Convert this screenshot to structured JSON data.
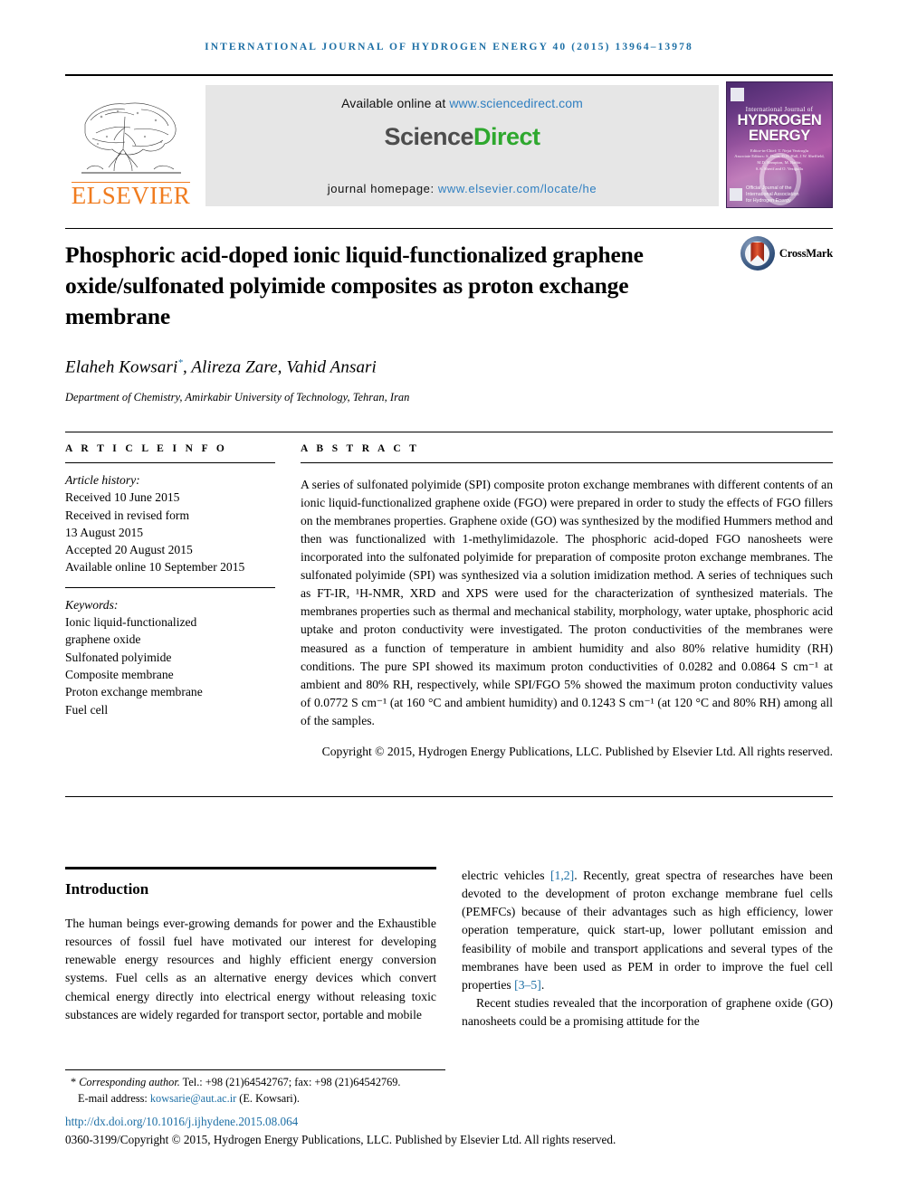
{
  "running_head": "International Journal of Hydrogen Energy 40 (2015) 13964–13978",
  "masthead": {
    "publisher_name": "ELSEVIER",
    "available_prefix": "Available online at ",
    "available_url": "www.sciencedirect.com",
    "sciencedirect_part1": "Science",
    "sciencedirect_part2": "Direct",
    "homepage_prefix": "journal homepage: ",
    "homepage_url": "www.elsevier.com/locate/he",
    "cover": {
      "line_small": "International Journal of",
      "line_big_1": "HYDROGEN",
      "line_big_2": "ENERGY",
      "editor_lines": "Editor-in-Chief: T. Nejat Veziroglu\nAssociate Editors: S. Dunn, D.O. Hall, J.W. Sheffield,\nM.D. Hampton, M. Barbir,\nS.A. Sherif and O. Veziğullu",
      "footer_text": "Official Journal of the\nInternational Association\nfor Hydrogen Energy"
    }
  },
  "article": {
    "title": "Phosphoric acid-doped ionic liquid-functionalized graphene oxide/sulfonated polyimide composites as proton exchange membrane",
    "crossmark_label": "CrossMark",
    "authors": "Elaheh Kowsari",
    "authors_star": "*",
    "authors_rest": ", Alireza Zare, Vahid Ansari",
    "affiliation": "Department of Chemistry, Amirkabir University of Technology, Tehran, Iran"
  },
  "article_info": {
    "section_label": "A R T I C L E   I N F O",
    "history_label": "Article history:",
    "history": [
      "Received 10 June 2015",
      "Received in revised form",
      "13 August 2015",
      "Accepted 20 August 2015",
      "Available online 10 September 2015"
    ],
    "keywords_label": "Keywords:",
    "keywords": [
      "Ionic liquid-functionalized",
      "graphene oxide",
      "Sulfonated polyimide",
      "Composite membrane",
      "Proton exchange membrane",
      "Fuel cell"
    ]
  },
  "abstract": {
    "section_label": "A B S T R A C T",
    "body": "A series of sulfonated polyimide (SPI) composite proton exchange membranes with different contents of an ionic liquid-functionalized graphene oxide (FGO) were prepared in order to study the effects of FGO fillers on the membranes properties. Graphene oxide (GO) was synthesized by the modified Hummers method and then was functionalized with 1-methylimidazole. The phosphoric acid-doped FGO nanosheets were incorporated into the sulfonated polyimide for preparation of composite proton exchange membranes. The sulfonated polyimide (SPI) was synthesized via a solution imidization method. A series of techniques such as FT-IR, ¹H-NMR, XRD and XPS were used for the characterization of synthesized materials. The membranes properties such as thermal and mechanical stability, morphology, water uptake, phosphoric acid uptake and proton conductivity were investigated. The proton conductivities of the membranes were measured as a function of temperature in ambient humidity and also 80% relative humidity (RH) conditions. The pure SPI showed its maximum proton conductivities of 0.0282 and 0.0864 S cm⁻¹ at ambient and 80% RH, respectively, while SPI/FGO 5% showed the maximum proton conductivity values of 0.0772 S cm⁻¹ (at 160 °C and ambient humidity) and 0.1243 S cm⁻¹ (at 120 °C and 80% RH) among all of the samples.",
    "copyright": "Copyright © 2015, Hydrogen Energy Publications, LLC. Published by Elsevier Ltd. All rights reserved."
  },
  "introduction": {
    "heading": "Introduction",
    "paragraph_1_left": "The human beings ever-growing demands for power and the Exhaustible resources of fossil fuel have motivated our interest for developing renewable energy resources and highly efficient energy conversion systems. Fuel cells as an alternative energy devices which convert chemical energy directly into electrical energy without releasing toxic substances are widely regarded for transport sector, portable and mobile",
    "paragraph_1_right_a": "electric vehicles ",
    "ref_1": "[1,2]",
    "paragraph_1_right_b": ". Recently, great spectra of researches have been devoted to the development of proton exchange membrane fuel cells (PEMFCs) because of their advantages such as high efficiency, lower operation temperature, quick start-up, lower pollutant emission and feasibility of mobile and transport applications and several types of the membranes have been used as PEM in order to improve the fuel cell properties ",
    "ref_2": "[3–5]",
    "paragraph_1_right_c": ".",
    "paragraph_2_right": "Recent studies revealed that the incorporation of graphene oxide (GO) nanosheets could be a promising attitude for the"
  },
  "footer": {
    "corresponding_star": "*",
    "corresponding_label": " Corresponding author.",
    "corresponding_contact": " Tel.: +98 (21)64542767; fax: +98 (21)64542769.",
    "email_label": "E-mail address: ",
    "email": "kowsarie@aut.ac.ir",
    "email_suffix": " (E. Kowsari).",
    "doi": "http://dx.doi.org/10.1016/j.ijhydene.2015.08.064",
    "issn_line": "0360-3199/Copyright © 2015, Hydrogen Energy Publications, LLC. Published by Elsevier Ltd. All rights reserved."
  },
  "colors": {
    "link": "#1d6fa5",
    "elsevier_orange": "#f07c1f",
    "sciencedirect_green": "#2ea82e",
    "sd_link_blue": "#2f7fc1"
  }
}
